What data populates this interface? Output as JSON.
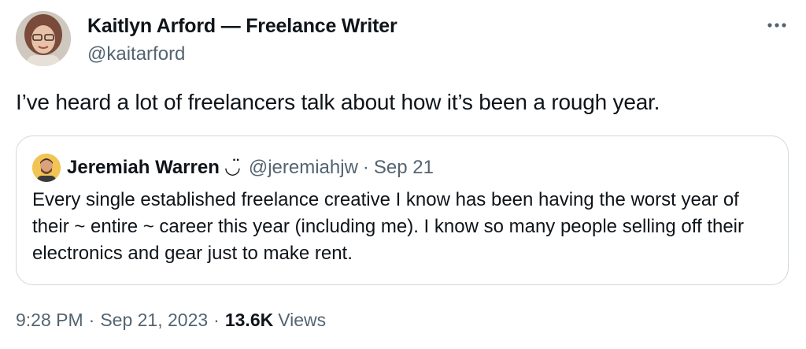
{
  "tweet": {
    "author": {
      "name": "Kaitlyn Arford — Freelance Writer",
      "handle": "@kaitarford"
    },
    "more_icon": "more-horizontal-icon",
    "text": "I’ve heard a lot of freelancers talk about how it’s been a rough year.",
    "quoted": {
      "name": "Jeremiah Warren",
      "name_emoji": "◡̈",
      "handle": "@jeremiahjw",
      "separator": "·",
      "date": "Sep 21",
      "text": "Every single established freelance creative I know has been having the worst year of their ~ entire ~ career this year (including me). I know so many people selling off their electronics and gear just to make rent."
    },
    "meta": {
      "time": "9:28 PM",
      "separator": "·",
      "date": "Sep 21, 2023",
      "views_count": "13.6K",
      "views_label": "Views"
    },
    "colors": {
      "text": "#0f1419",
      "secondary": "#536471",
      "border": "#cfd9de"
    }
  }
}
